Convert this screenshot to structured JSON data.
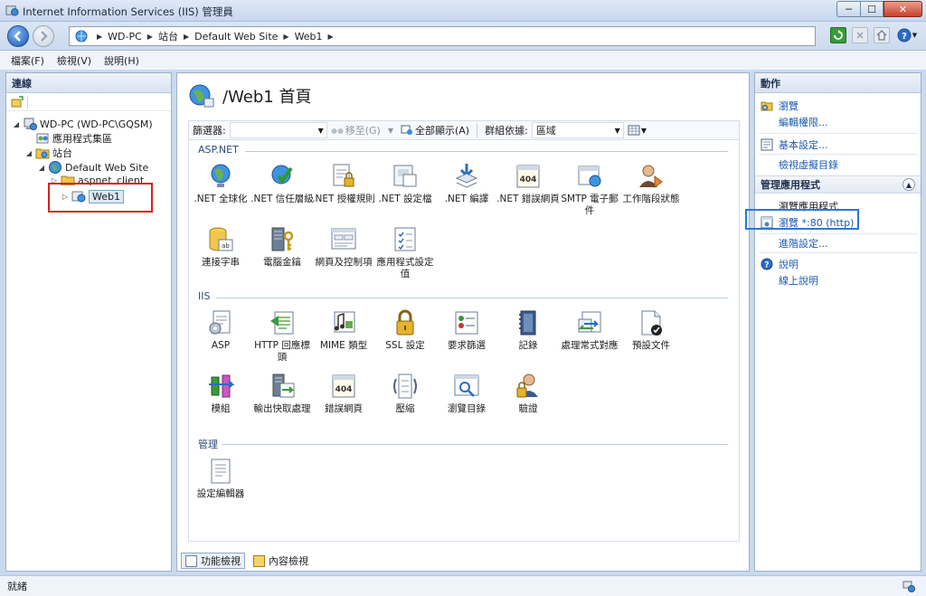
{
  "window": {
    "title": "Internet Information Services (IIS) 管理員",
    "min_glyph": "─",
    "max_glyph": "☐",
    "close_glyph": "✕"
  },
  "address": {
    "crumbs": [
      "WD-PC",
      "站台",
      "Default Web Site",
      "Web1"
    ]
  },
  "menu": [
    "檔案(F)",
    "檢視(V)",
    "說明(H)"
  ],
  "left_panel": {
    "header": "連線",
    "tree": [
      {
        "label": "WD-PC (WD-PC\\GQSM)",
        "icon": "server-icon"
      },
      {
        "label": "應用程式集區",
        "icon": "app-pools-icon"
      },
      {
        "label": "站台",
        "icon": "sites-folder-icon"
      },
      {
        "label": "Default Web Site",
        "icon": "globe-icon"
      },
      {
        "label": "aspnet_client",
        "icon": "folder-icon"
      },
      {
        "label": "Web1",
        "icon": "web-app-icon"
      }
    ]
  },
  "center": {
    "title": "/Web1 首頁",
    "filter": {
      "label": "篩選器:",
      "go": "移至(G)",
      "show_all": "全部顯示(A)",
      "group_by": "群組依據:",
      "group_value": "區域"
    },
    "sections": [
      {
        "name": "ASP.NET",
        "features": [
          {
            "label": ".NET 全球化",
            "icon": "globalization-icon"
          },
          {
            "label": ".NET 信任層級",
            "icon": "trust-level-icon"
          },
          {
            "label": ".NET 授權規則",
            "icon": "authorization-rules-icon"
          },
          {
            "label": ".NET 設定檔",
            "icon": "profile-icon"
          },
          {
            "label": ".NET 編譯",
            "icon": "compilation-icon"
          },
          {
            "label": ".NET 錯誤網頁",
            "icon": "error-pages-icon"
          },
          {
            "label": "SMTP 電子郵件",
            "icon": "smtp-icon"
          },
          {
            "label": "工作階段狀態",
            "icon": "session-state-icon"
          },
          {
            "label": "連接字串",
            "icon": "connection-strings-icon"
          },
          {
            "label": "電腦金鑰",
            "icon": "machine-key-icon"
          },
          {
            "label": "網頁及控制項",
            "icon": "pages-controls-icon"
          },
          {
            "label": "應用程式設定值",
            "icon": "app-settings-icon"
          }
        ]
      },
      {
        "name": "IIS",
        "features": [
          {
            "label": "ASP",
            "icon": "asp-icon"
          },
          {
            "label": "HTTP 回應標頭",
            "icon": "http-headers-icon"
          },
          {
            "label": "MIME 類型",
            "icon": "mime-types-icon"
          },
          {
            "label": "SSL 設定",
            "icon": "ssl-lock-icon"
          },
          {
            "label": "要求篩選",
            "icon": "request-filtering-icon"
          },
          {
            "label": "記錄",
            "icon": "logging-icon"
          },
          {
            "label": "處理常式對應",
            "icon": "handler-mappings-icon"
          },
          {
            "label": "預設文件",
            "icon": "default-document-icon"
          },
          {
            "label": "模組",
            "icon": "modules-icon"
          },
          {
            "label": "輸出快取處理",
            "icon": "output-caching-icon"
          },
          {
            "label": "錯誤網頁",
            "icon": "error-pages-iis-icon"
          },
          {
            "label": "壓縮",
            "icon": "compression-icon"
          },
          {
            "label": "瀏覽目錄",
            "icon": "directory-browsing-icon"
          },
          {
            "label": "驗證",
            "icon": "authentication-icon"
          }
        ]
      },
      {
        "name": "管理",
        "features": [
          {
            "label": "設定編輯器",
            "icon": "configuration-editor-icon"
          }
        ]
      }
    ],
    "view_tabs": [
      "功能檢視",
      "內容檢視"
    ]
  },
  "right_panel": {
    "header": "動作",
    "explore": "瀏覽",
    "edit_permissions": "編輯權限...",
    "basic_settings": "基本設定...",
    "view_virtual_dirs": "檢視虛擬目錄",
    "manage_group": "管理應用程式",
    "browse_app_label": "瀏覽應用程式",
    "browse_http": "瀏覽 *:80 (http)",
    "advanced_settings": "進階設定...",
    "help": "說明",
    "online_help": "線上說明"
  },
  "status": {
    "text": "就緒"
  },
  "colors": {
    "accent": "#1c5bb0",
    "highlight_red": "#d82020",
    "highlight_blue": "#2a78d8"
  }
}
